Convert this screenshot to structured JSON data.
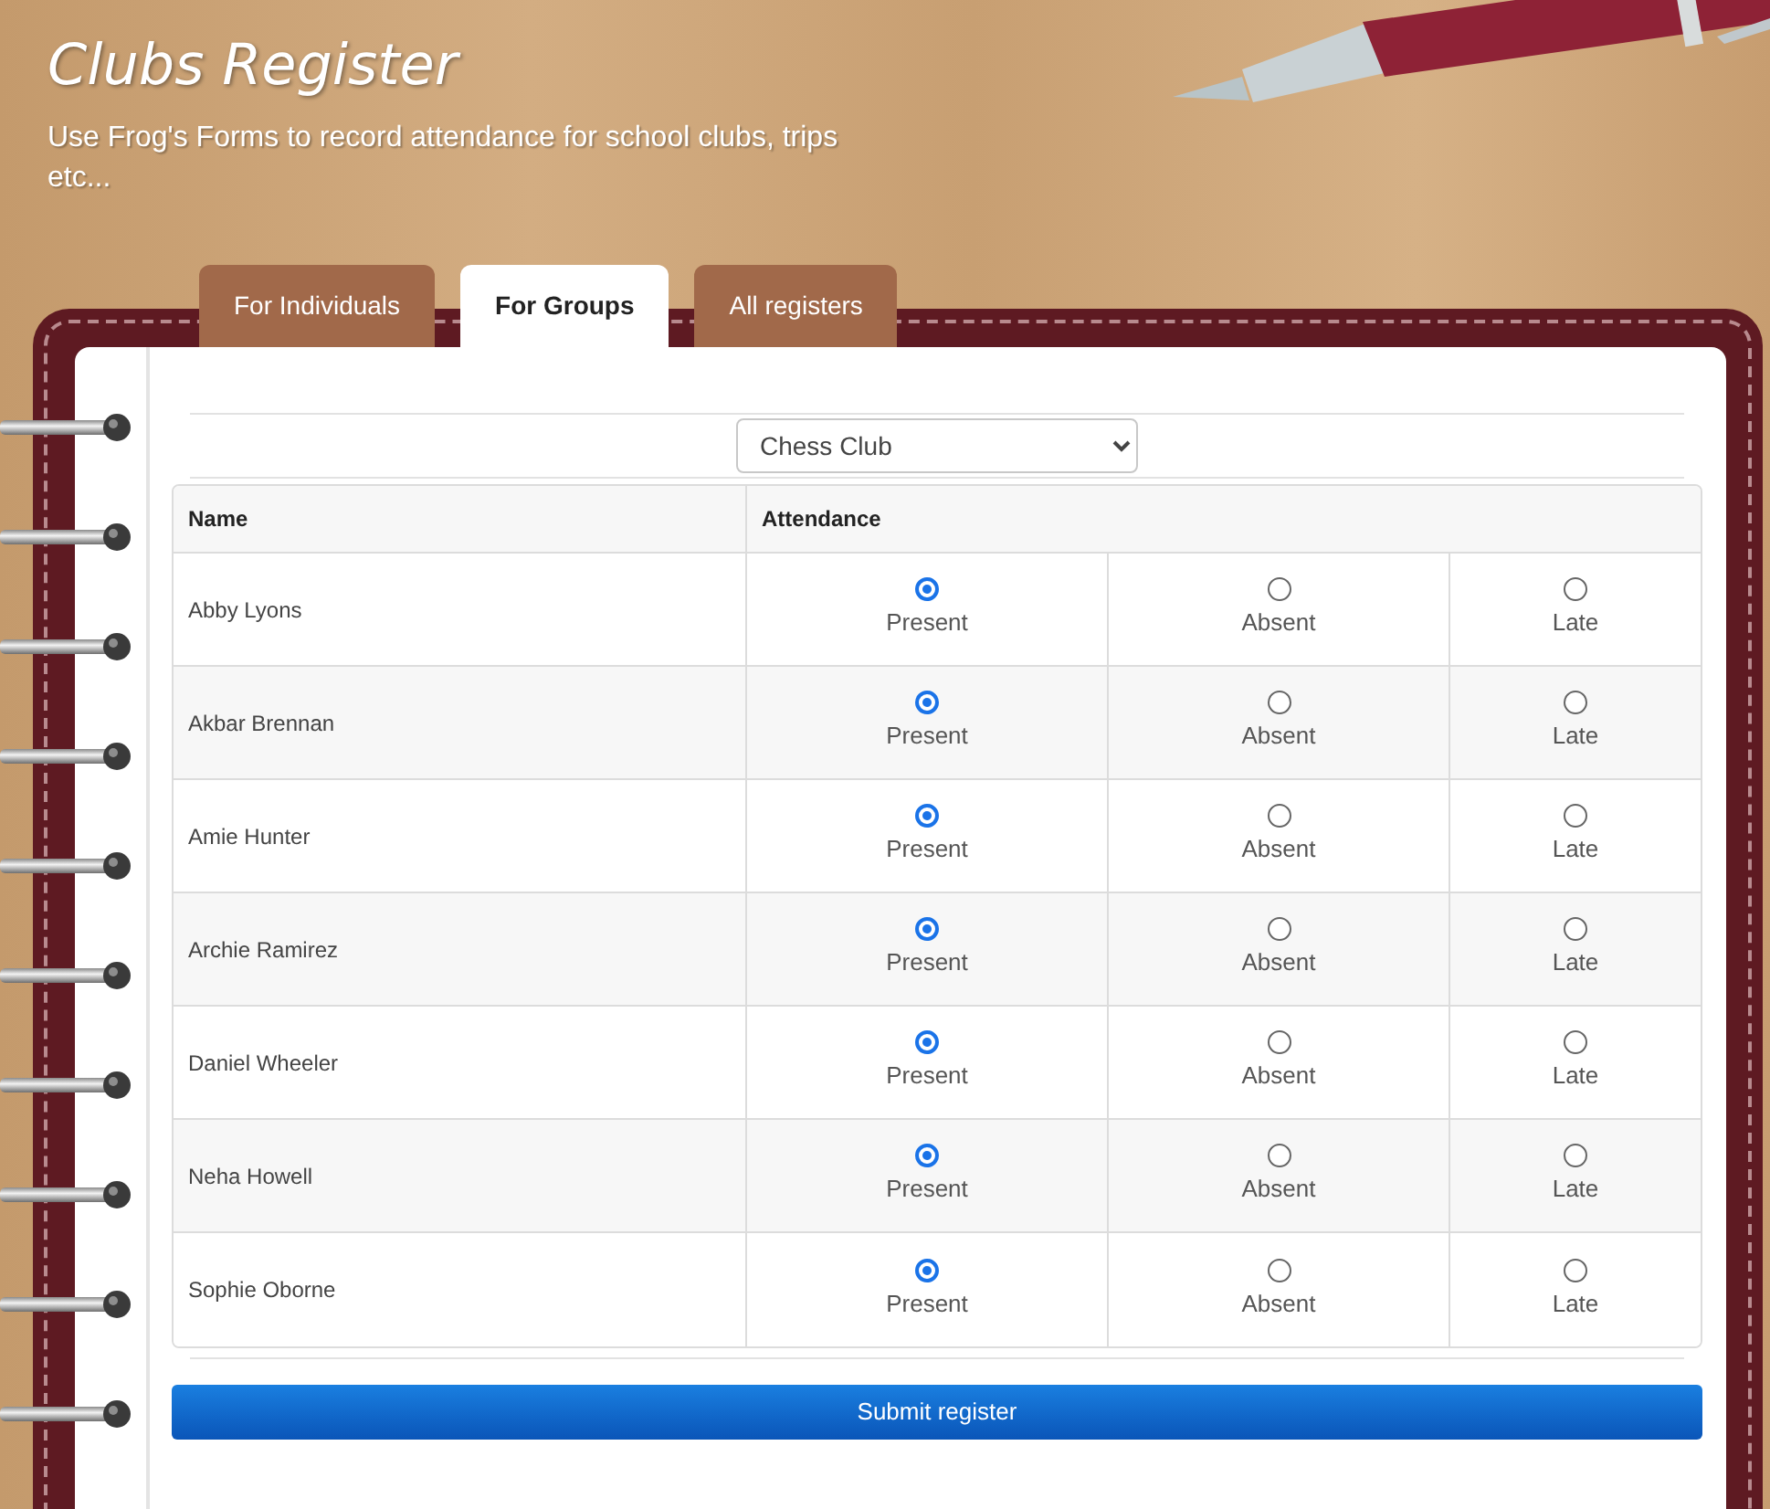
{
  "header": {
    "title": "Clubs Register",
    "subtitle": "Use Frog's Forms to record attendance for school clubs, trips etc..."
  },
  "tabs": [
    {
      "label": "For Individuals",
      "selected": false
    },
    {
      "label": "For Groups",
      "selected": true
    },
    {
      "label": "All registers",
      "selected": false
    }
  ],
  "club_select": {
    "value": "Chess Club"
  },
  "register": {
    "columns": [
      "Name",
      "Attendance"
    ],
    "rows": [
      {
        "name": "Abby Lyons",
        "options": [
          {
            "label": "Present",
            "selected": true
          },
          {
            "label": "Absent",
            "selected": false
          },
          {
            "label": "Late",
            "selected": false
          }
        ]
      },
      {
        "name": "Akbar Brennan",
        "options": [
          {
            "label": "Present",
            "selected": true
          },
          {
            "label": "Absent",
            "selected": false
          },
          {
            "label": "Late",
            "selected": false
          }
        ]
      },
      {
        "name": "Amie Hunter",
        "options": [
          {
            "label": "Present",
            "selected": true
          },
          {
            "label": "Absent",
            "selected": false
          },
          {
            "label": "Late",
            "selected": false
          }
        ]
      },
      {
        "name": "Archie Ramirez",
        "options": [
          {
            "label": "Present",
            "selected": true
          },
          {
            "label": "Absent",
            "selected": false
          },
          {
            "label": "Late",
            "selected": false
          }
        ]
      },
      {
        "name": "Daniel Wheeler",
        "options": [
          {
            "label": "Present",
            "selected": true
          },
          {
            "label": "Absent",
            "selected": false
          },
          {
            "label": "Late",
            "selected": false
          }
        ]
      },
      {
        "name": "Neha Howell",
        "options": [
          {
            "label": "Present",
            "selected": true
          },
          {
            "label": "Absent",
            "selected": false
          },
          {
            "label": "Late",
            "selected": false
          }
        ]
      },
      {
        "name": "Sophie Oborne",
        "options": [
          {
            "label": "Present",
            "selected": true
          },
          {
            "label": "Absent",
            "selected": false
          },
          {
            "label": "Late",
            "selected": false
          }
        ]
      }
    ]
  },
  "submit_button": {
    "label": "Submit register"
  }
}
